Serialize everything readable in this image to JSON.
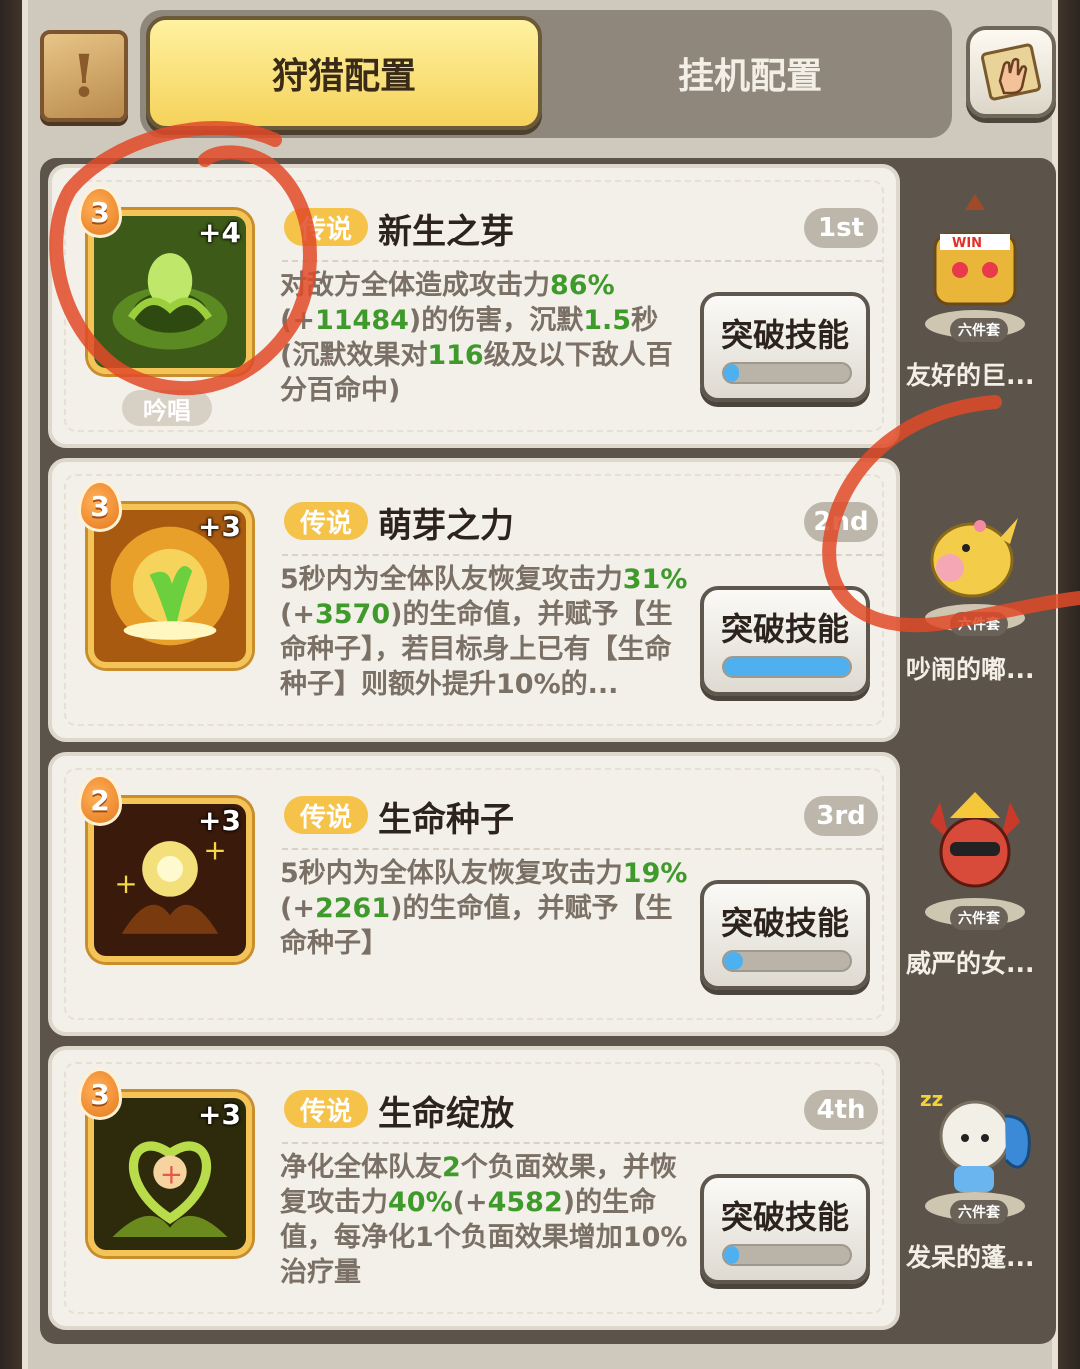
{
  "tabs": {
    "hunt_label": "狩猎配置",
    "idle_label": "挂机配置"
  },
  "colors": {
    "highlight_green": "#3f9a2c",
    "rarity_gold": "#f5c24a",
    "progress_blue": "#4fb0f0",
    "annotation_red": "#e04a28"
  },
  "icons": {
    "quest_scroll": "quest-scroll-icon",
    "map_hand": "map-hand-icon"
  },
  "skills": [
    {
      "level": "3",
      "plus": "+4",
      "chant": "吟唱",
      "rarity": "传说",
      "name": "新生之芽",
      "rank": "1st",
      "desc": [
        {
          "t": "对敌方全体造成攻击力"
        },
        {
          "t": "86%",
          "g": true
        },
        {
          "t": "(+"
        },
        {
          "t": "11484",
          "g": true
        },
        {
          "t": ")的伤害，沉默"
        },
        {
          "t": "1.5",
          "g": true
        },
        {
          "t": "秒(沉默效果对"
        },
        {
          "t": "116",
          "g": true
        },
        {
          "t": "级及以下敌人百分百命中)"
        }
      ],
      "button": "突破技能",
      "progress": 0.08,
      "pet_set": "六件套",
      "pet_name": "友好的巨..."
    },
    {
      "level": "3",
      "plus": "+3",
      "chant": "",
      "rarity": "传说",
      "name": "萌芽之力",
      "rank": "2nd",
      "desc": [
        {
          "t": "5秒内为全体队友恢复攻击力"
        },
        {
          "t": "31%",
          "g": true
        },
        {
          "t": "(+"
        },
        {
          "t": "3570",
          "g": true
        },
        {
          "t": ")的生命值，并赋予【生命种子】，若目标身上已有【生命种子】则额外提升10%的..."
        }
      ],
      "button": "突破技能",
      "progress": 1.0,
      "pet_set": "六件套",
      "pet_name": "吵闹的嘟..."
    },
    {
      "level": "2",
      "plus": "+3",
      "chant": "",
      "rarity": "传说",
      "name": "生命种子",
      "rank": "3rd",
      "desc": [
        {
          "t": "5秒内为全体队友恢复攻击力"
        },
        {
          "t": "19%",
          "g": true
        },
        {
          "t": "(+"
        },
        {
          "t": "2261",
          "g": true
        },
        {
          "t": ")的生命值，并赋予【生命种子】"
        }
      ],
      "button": "突破技能",
      "progress": 0.15,
      "pet_set": "六件套",
      "pet_name": "威严的女..."
    },
    {
      "level": "3",
      "plus": "+3",
      "chant": "",
      "rarity": "传说",
      "name": "生命绽放",
      "rank": "4th",
      "desc": [
        {
          "t": "净化全体队友"
        },
        {
          "t": "2",
          "g": true
        },
        {
          "t": "个负面效果，并恢复攻击力"
        },
        {
          "t": "40%",
          "g": true
        },
        {
          "t": "(+"
        },
        {
          "t": "4582",
          "g": true
        },
        {
          "t": ")的生命值，每净化1个负面效果增加10%治疗量"
        }
      ],
      "button": "突破技能",
      "progress": 0.08,
      "pet_set": "六件套",
      "pet_name": "发呆的蓬..."
    }
  ]
}
